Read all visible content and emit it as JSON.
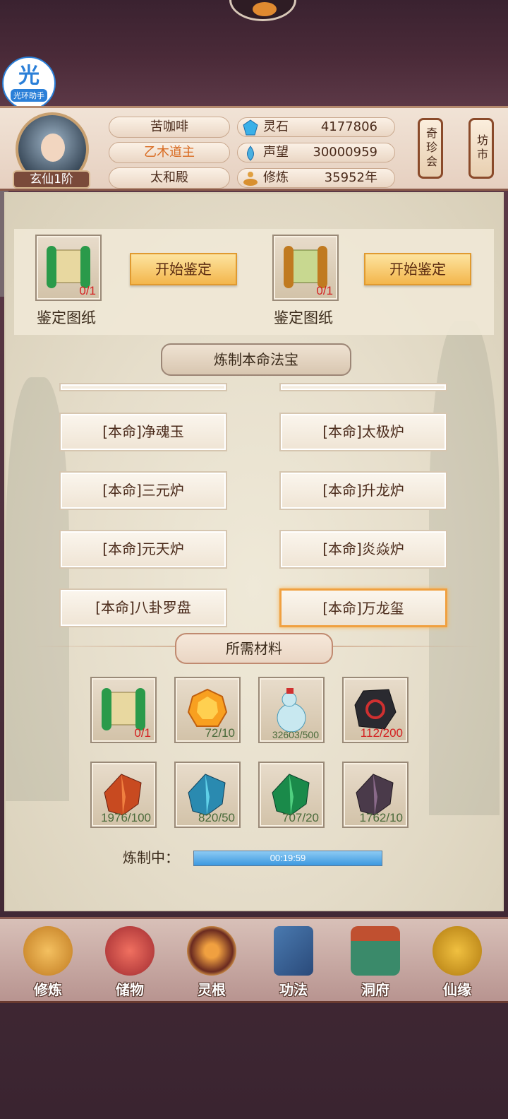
{
  "helper": {
    "glyph": "光",
    "label": "光环助手"
  },
  "player": {
    "name": "苦咖啡",
    "title": "乙木道主",
    "sect": "太和殿",
    "rank": "玄仙1阶"
  },
  "stats": [
    {
      "label": "灵石",
      "value": "4177806",
      "icon": "spirit-stone-icon"
    },
    {
      "label": "声望",
      "value": "30000959",
      "icon": "prestige-icon"
    },
    {
      "label": "修炼",
      "value": "35952年",
      "icon": "meditate-icon"
    }
  ],
  "side_buttons": [
    {
      "label": "奇珍会"
    },
    {
      "label": "坊市"
    }
  ],
  "appraise": [
    {
      "count": "0/1",
      "button": "开始鉴定",
      "label": "鉴定图纸"
    },
    {
      "count": "0/1",
      "button": "开始鉴定",
      "label": "鉴定图纸"
    }
  ],
  "forge_banner": "炼制本命法宝",
  "recipes": [
    "[本命]净魂玉",
    "[本命]太极炉",
    "[本命]三元炉",
    "[本命]升龙炉",
    "[本命]元天炉",
    "[本命]炎焱炉",
    "[本命]八卦罗盘",
    "[本命]万龙玺"
  ],
  "selected_recipe": "[本命]万龙玺",
  "materials_banner": "所需材料",
  "materials": [
    {
      "count": "0/1",
      "status": "insufficient",
      "icon": "scroll-icon"
    },
    {
      "count": "72/10",
      "status": "sufficient",
      "icon": "amber-gem-icon"
    },
    {
      "count": "32603/500",
      "status": "sufficient",
      "icon": "gourd-bottle-icon"
    },
    {
      "count": "112/200",
      "status": "insufficient",
      "icon": "dark-ore-icon"
    },
    {
      "count": "1976/100",
      "status": "sufficient",
      "icon": "red-crystal-icon"
    },
    {
      "count": "820/50",
      "status": "sufficient",
      "icon": "blue-crystal-icon"
    },
    {
      "count": "707/20",
      "status": "sufficient",
      "icon": "green-crystal-icon"
    },
    {
      "count": "1762/10",
      "status": "sufficient",
      "icon": "purple-crystal-icon"
    }
  ],
  "progress": {
    "label": "炼制中：",
    "time": "00:19:59",
    "fraction": 1.0
  },
  "nav": [
    {
      "label": "修炼",
      "icon": "meditation-icon"
    },
    {
      "label": "储物",
      "icon": "storage-bag-icon"
    },
    {
      "label": "灵根",
      "icon": "spirit-root-icon"
    },
    {
      "label": "功法",
      "icon": "book-icon"
    },
    {
      "label": "洞府",
      "icon": "cave-palace-icon"
    },
    {
      "label": "仙缘",
      "icon": "gourd-icon"
    }
  ],
  "colors": {
    "insufficient": "#d42020",
    "sufficient": "#4a6a3a",
    "accent": "#f3b64c"
  }
}
